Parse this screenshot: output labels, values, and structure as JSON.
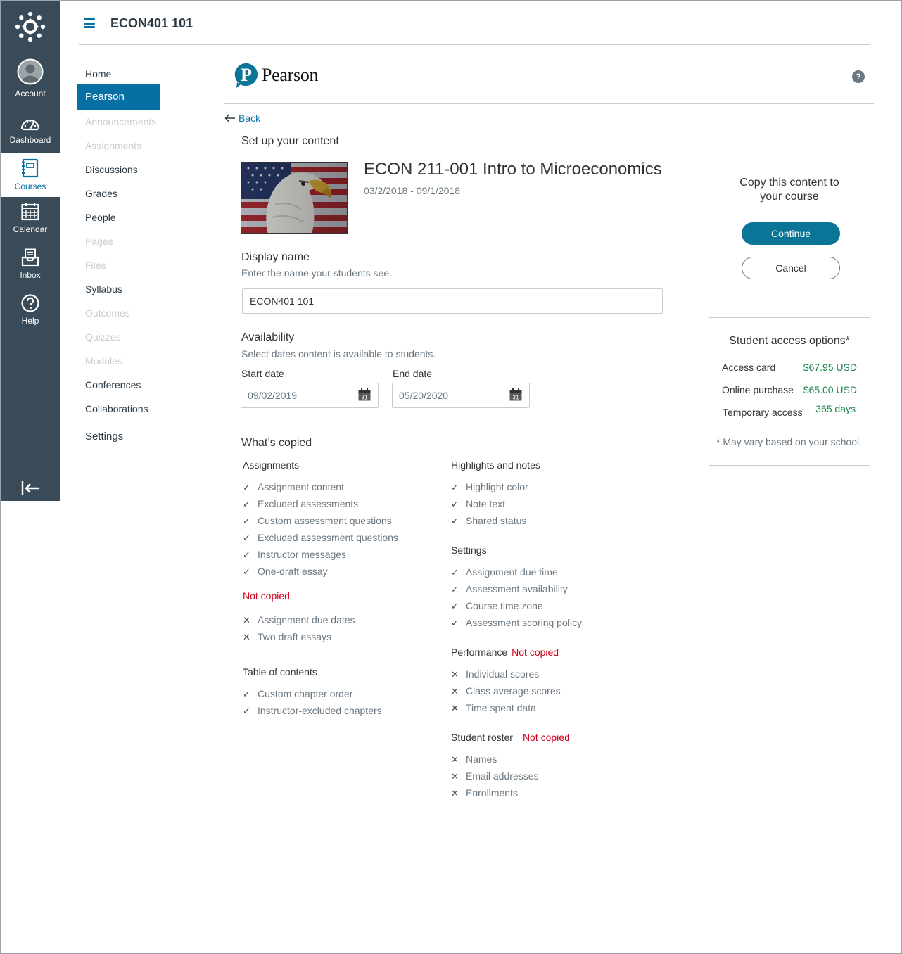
{
  "global_nav": {
    "items": [
      {
        "label": "Account",
        "icon": "account-avatar-icon"
      },
      {
        "label": "Dashboard",
        "icon": "dashboard-icon"
      },
      {
        "label": "Courses",
        "icon": "courses-icon"
      },
      {
        "label": "Calendar",
        "icon": "calendar-icon"
      },
      {
        "label": "Inbox",
        "icon": "inbox-icon"
      },
      {
        "label": "Help",
        "icon": "help-icon"
      }
    ],
    "active": "Courses"
  },
  "header": {
    "course_title": "ECON401 101"
  },
  "course_nav": {
    "items": [
      {
        "label": "Home"
      },
      {
        "label": "Pearson"
      },
      {
        "label": "Announcements"
      },
      {
        "label": "Assignments"
      },
      {
        "label": "Discussions"
      },
      {
        "label": "Grades"
      },
      {
        "label": "People"
      },
      {
        "label": "Pages"
      },
      {
        "label": "Files"
      },
      {
        "label": "Syllabus"
      },
      {
        "label": "Outcomes"
      },
      {
        "label": "Quizzes"
      },
      {
        "label": "Modules"
      },
      {
        "label": "Conferences"
      },
      {
        "label": "Collaborations"
      },
      {
        "label": "Settings"
      }
    ],
    "active": "Pearson"
  },
  "pearson": {
    "brand": "Pearson",
    "back_label": "Back",
    "setup_title": "Set up your content",
    "product_title": "ECON 211-001 Intro to Microeconomics",
    "product_dates": "03/2/2018 - 09/1/2018",
    "display_name": {
      "title": "Display name",
      "hint": "Enter the name your students see.",
      "value": "ECON401 101"
    },
    "availability": {
      "title": "Availability",
      "hint": "Select dates content is available to students.",
      "start_label": "Start date",
      "start_value": "09/02/2019",
      "end_label": "End date",
      "end_value": "05/20/2020",
      "calendar_day": "31"
    },
    "whats_copied": {
      "title": "What’s copied",
      "not_copied_label": "Not copied",
      "assignments": {
        "title": "Assignments",
        "copied": [
          "Assignment content",
          "Excluded assessments",
          "Custom assessment questions",
          "Excluded assessment questions",
          "Instructor messages",
          "One-draft essay"
        ],
        "not_copied": [
          "Assignment due dates",
          "Two draft essays"
        ]
      },
      "toc": {
        "title": "Table of contents",
        "copied": [
          "Custom chapter order",
          "Instructor-excluded chapters"
        ]
      },
      "highlights": {
        "title": "Highlights and notes",
        "copied": [
          "Highlight color",
          "Note text",
          "Shared status"
        ]
      },
      "settings": {
        "title": "Settings",
        "copied": [
          "Assignment due time",
          "Assessment availability",
          "Course time zone",
          "Assessment scoring policy"
        ]
      },
      "performance": {
        "title": "Performance",
        "not_copied": [
          "Individual scores",
          "Class average scores",
          "Time spent data"
        ]
      },
      "roster": {
        "title": "Student roster",
        "not_copied": [
          "Names",
          "Email addresses",
          "Enrollments"
        ]
      }
    },
    "copy_panel": {
      "title_line1": "Copy this content to",
      "title_line2": "your course",
      "continue_label": "Continue",
      "cancel_label": "Cancel"
    },
    "access_panel": {
      "title": "Student access options*",
      "rows": [
        {
          "label": "Access card",
          "value": "$67.95 USD"
        },
        {
          "label": "Online purchase",
          "value": "$65.00 USD"
        },
        {
          "label": "Temporary access",
          "value": "365 days"
        }
      ],
      "note": "* May vary based on your school."
    }
  },
  "colors": {
    "nav_bg": "#394b58",
    "brand_blue": "#0770a3",
    "pearson_teal": "#0a7596",
    "price_green": "#19854b",
    "not_copied_red": "#d0021b"
  }
}
